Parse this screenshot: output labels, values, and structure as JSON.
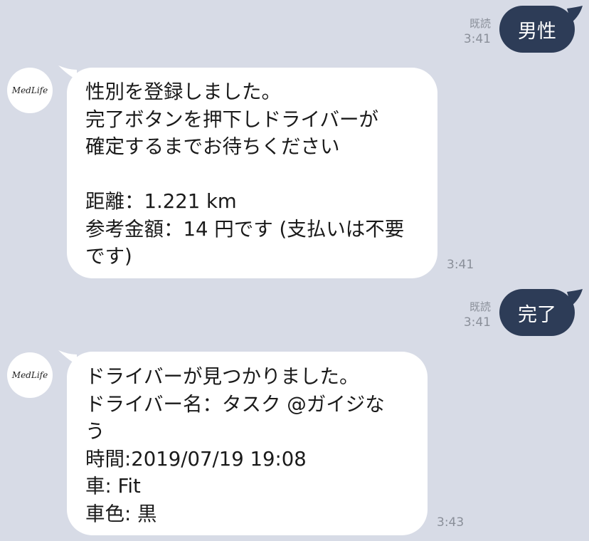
{
  "messages": [
    {
      "direction": "out",
      "text": "男性",
      "read": "既読",
      "time": "3:41"
    },
    {
      "direction": "in",
      "sender": "MedLife",
      "lines": [
        "性別を登録しました。",
        "完了ボタンを押下しドライバーが",
        "確定するまでお待ちください",
        "",
        "距離：1.221 km",
        "参考金額：14 円です (支払いは不要",
        "です)"
      ],
      "time": "3:41"
    },
    {
      "direction": "out",
      "text": "完了",
      "read": "既読",
      "time": "3:41"
    },
    {
      "direction": "in",
      "sender": "MedLife",
      "lines": [
        "ドライバーが見つかりました。",
        "ドライバー名：タスク @ガイジな",
        "う",
        "時間:2019/07/19 19:08",
        "車: Fit",
        "車色: 黒"
      ],
      "time": "3:43"
    }
  ],
  "colors": {
    "background": "#d7dbe6",
    "outgoing_bubble": "#2d3c57",
    "incoming_bubble": "#ffffff",
    "meta_text": "#8a8f99"
  }
}
